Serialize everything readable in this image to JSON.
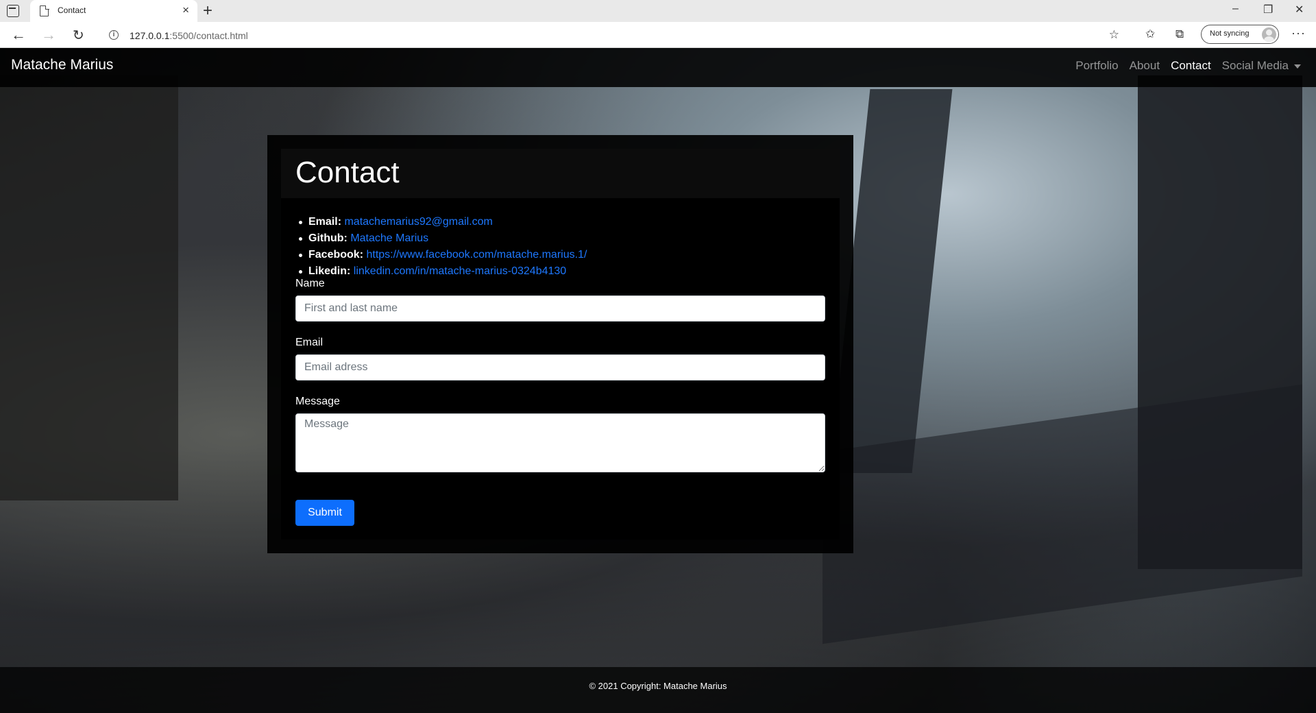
{
  "browser": {
    "tab_title": "Contact",
    "tab_close": "×",
    "new_tab": "+",
    "url_host": "127.0.0.1",
    "url_rest": ":5500/contact.html",
    "sync_label": "Not syncing",
    "window_controls": [
      "–",
      "❐",
      "✕"
    ]
  },
  "navbar": {
    "brand": "Matache Marius",
    "links": [
      {
        "label": "Portfolio",
        "active": false
      },
      {
        "label": "About",
        "active": false
      },
      {
        "label": "Contact",
        "active": true
      },
      {
        "label": "Social Media",
        "active": false,
        "dropdown": true
      }
    ]
  },
  "contact": {
    "title": "Contact",
    "items": [
      {
        "label": "Email:",
        "value": "matachemarius92@gmail.com"
      },
      {
        "label": "Github:",
        "value": "Matache Marius"
      },
      {
        "label": "Facebook:",
        "value": "https://www.facebook.com/matache.marius.1/"
      },
      {
        "label": "Likedin:",
        "value": "linkedin.com/in/matache-marius-0324b4130"
      }
    ]
  },
  "form": {
    "name_label": "Name",
    "name_placeholder": "First and last name",
    "email_label": "Email",
    "email_placeholder": "Email adress",
    "message_label": "Message",
    "message_placeholder": "Message",
    "submit_label": "Submit"
  },
  "footer": {
    "text": "© 2021 Copyright: Matache Marius"
  },
  "colors": {
    "link": "#1e78ff",
    "primary_button": "#0d6efd"
  }
}
